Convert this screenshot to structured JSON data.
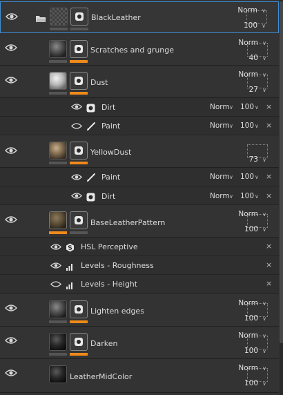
{
  "colors": {
    "accent": "#ef8a1a",
    "selection": "#3f8fd6",
    "panel": "#333333"
  },
  "layers": [
    {
      "name": "BlackLeather",
      "type": "folder",
      "visible": true,
      "blend": "Norm",
      "opacity": "100",
      "selected": true,
      "icon": "folder-icon",
      "thumb": "checker"
    },
    {
      "name": "Scratches and grunge",
      "type": "fill",
      "visible": true,
      "blend": "Norm",
      "opacity": "40",
      "thumb": "dark-sphere"
    },
    {
      "name": "Dust",
      "type": "fill",
      "visible": true,
      "blend": "Norm",
      "opacity": "27",
      "thumb": "light-sphere",
      "effects": [
        {
          "name": "Dirt",
          "visible": true,
          "icon": "generator-icon",
          "blend": "Norm",
          "opacity": "100"
        },
        {
          "name": "Paint",
          "visible": false,
          "icon": "brush-icon",
          "blend": "Norm",
          "opacity": "100"
        }
      ]
    },
    {
      "name": "YellowDust",
      "type": "fill",
      "visible": true,
      "blend": "",
      "opacity": "73",
      "thumb": "tan-sphere",
      "effects": [
        {
          "name": "Paint",
          "visible": true,
          "icon": "brush-icon",
          "blend": "Norm",
          "opacity": "100"
        },
        {
          "name": "Dirt",
          "visible": true,
          "icon": "generator-icon",
          "blend": "Norm",
          "opacity": "100"
        }
      ]
    },
    {
      "name": "BaseLeatherPattern",
      "type": "fill",
      "visible": true,
      "blend": "Norm",
      "opacity": "100",
      "thumb": "brown-sphere",
      "filters": [
        {
          "name": "HSL Perceptive",
          "visible": true,
          "icon": "hsl-icon"
        },
        {
          "name": "Levels - Roughness",
          "visible": true,
          "icon": "levels-icon"
        },
        {
          "name": "Levels - Height",
          "visible": false,
          "icon": "levels-icon"
        }
      ]
    },
    {
      "name": "Lighten edges",
      "type": "fill",
      "visible": true,
      "blend": "Norm",
      "opacity": "100",
      "thumb": "dark-sphere"
    },
    {
      "name": "Darken",
      "type": "fill",
      "visible": true,
      "blend": "Norm",
      "opacity": "100",
      "thumb": "black-sphere"
    },
    {
      "name": "LeatherMidColor",
      "type": "fill",
      "visible": true,
      "blend": "Norm",
      "opacity": "100",
      "thumb": "black-sphere"
    }
  ],
  "symbols": {
    "chevron": "∨",
    "close": "×"
  }
}
